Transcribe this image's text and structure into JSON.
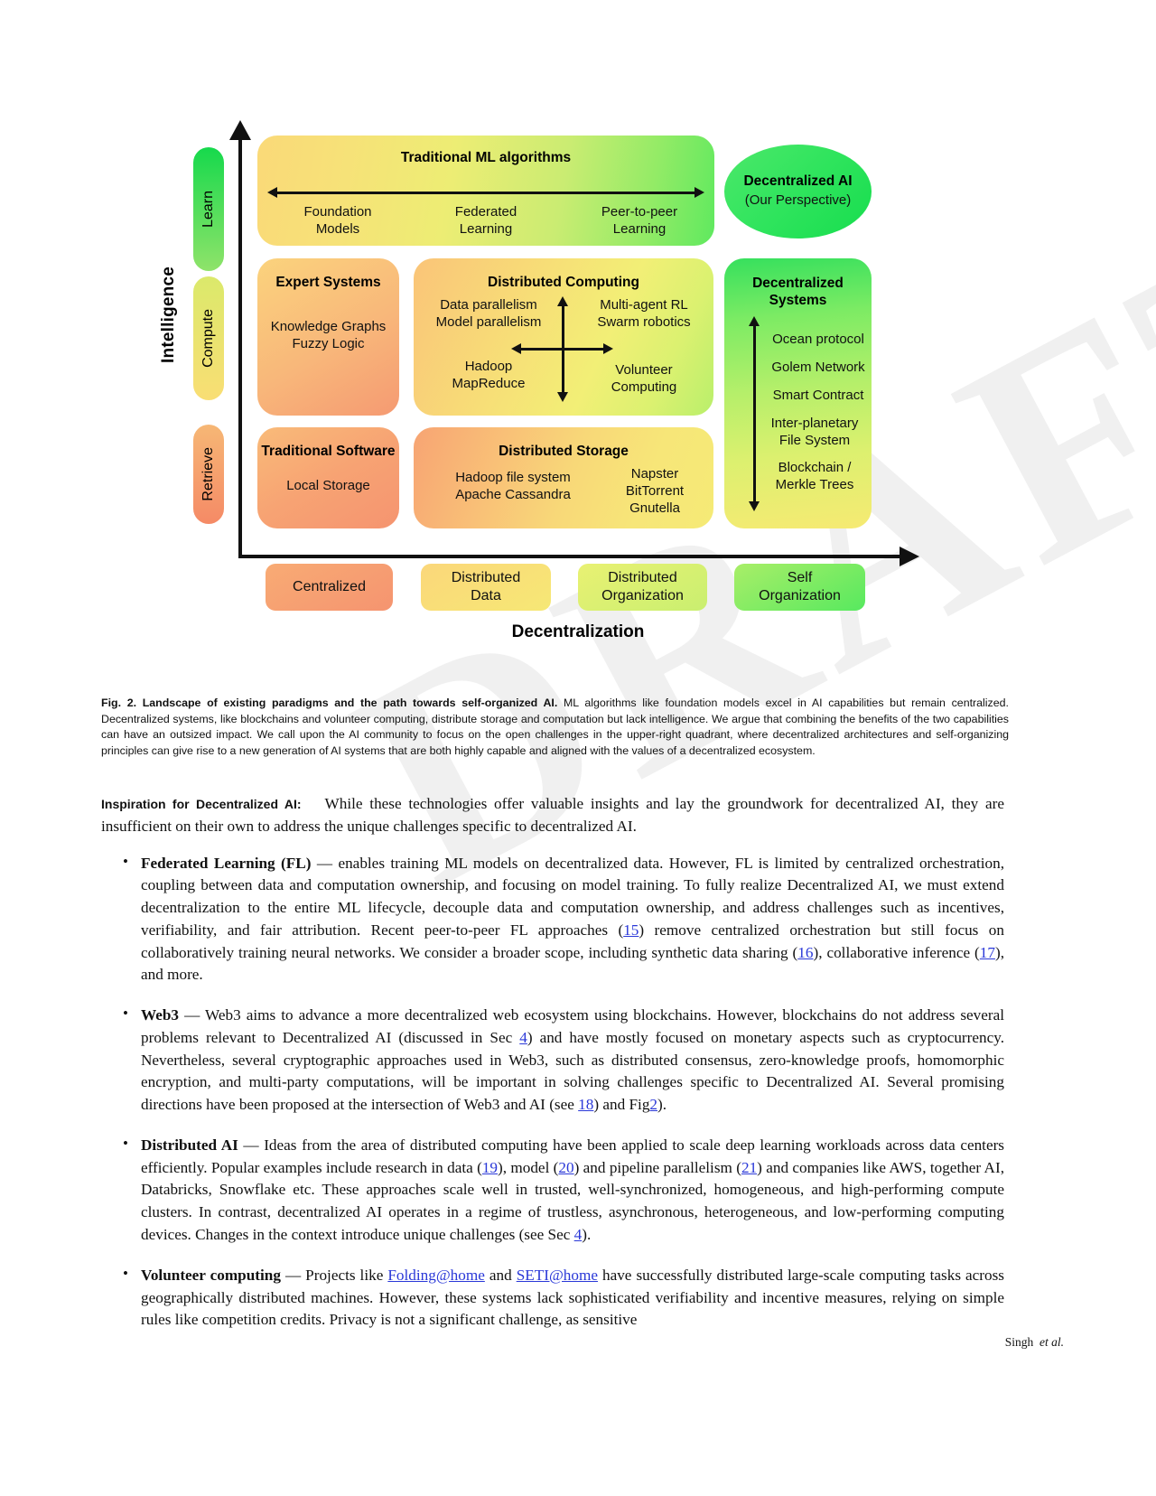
{
  "watermark": "DRAFT",
  "figure": {
    "y_axis_label": "Intelligence",
    "x_axis_label": "Decentralization",
    "tiers": [
      {
        "key": "learn",
        "label": "Learn"
      },
      {
        "key": "compute",
        "label": "Compute"
      },
      {
        "key": "retrieve",
        "label": "Retrieve"
      }
    ],
    "boxes": {
      "ml": {
        "title": "Traditional ML algorithms",
        "items": [
          "Foundation\nModels",
          "Federated\nLearning",
          "Peer-to-peer\nLearning"
        ],
        "item_left": "Foundation Models",
        "item_mid": "Federated Learning",
        "item_right": "Peer-to-peer Learning"
      },
      "dai": {
        "title": "Decentralized AI",
        "subtitle": "(Our Perspective)"
      },
      "expert": {
        "title": "Expert Systems",
        "items": "Knowledge Graphs\nFuzzy Logic"
      },
      "distributed_computing": {
        "title": "Distributed Computing",
        "tl": "Data parallelism\nModel parallelism",
        "tr": "Multi-agent RL\nSwarm robotics",
        "bl": "Hadoop\nMapReduce",
        "br": "Volunteer\nComputing"
      },
      "decentralized_systems": {
        "title": "Decentralized\nSystems",
        "items": [
          "Ocean protocol",
          "Golem Network",
          "Smart Contract",
          "Inter-planetary\nFile System",
          "Blockchain /\nMerkle Trees"
        ]
      },
      "traditional_software": {
        "title": "Traditional Software",
        "items": "Local Storage"
      },
      "distributed_storage": {
        "title": "Distributed Storage",
        "left": "Hadoop file system\nApache Cassandra",
        "right": "Napster\nBitTorrent\nGnutella"
      }
    },
    "x_categories": [
      "Centralized",
      "Distributed\nData",
      "Distributed\nOrganization",
      "Self\nOrganization"
    ],
    "colors": {
      "green": "#2fe45d",
      "yellow": "#f4e775",
      "orange": "#f59470",
      "axis": "#111111"
    }
  },
  "caption": {
    "label": "Fig. 2.",
    "bold_title": "Landscape of existing paradigms and the path towards self-organized AI.",
    "text": " ML algorithms like foundation models excel in AI capabilities but remain centralized. Decentralized systems, like blockchains and volunteer computing, distribute storage and computation but lack intelligence. We argue that combining the benefits of the two capabilities can have an outsized impact. We call upon the AI community to focus on the open challenges in the upper-right quadrant, where decentralized architectures and self-organizing principles can give rise to a new generation of AI systems that are both highly capable and aligned with the values of a decentralized ecosystem."
  },
  "body": {
    "lead_label": "Inspiration for Decentralized AI:",
    "lead_text": "While these technologies offer valuable insights and lay the groundwork for decentralized AI, they are insufficient on their own to address the unique challenges specific to decentralized AI.",
    "bullets": [
      {
        "term": "Federated Learning (FL)",
        "t1": " — enables training ML models on decentralized data. However, FL is limited by centralized orchestration, coupling between data and computation ownership, and focusing on model training. To fully realize Decentralized AI, we must extend decentralization to the entire ML lifecycle, decouple data and computation ownership, and address challenges such as incentives, verifiability, and fair attribution. Recent peer-to-peer FL approaches (",
        "r1": "15",
        "t2": ") remove centralized orchestration but still focus on collaboratively training neural networks. We consider a broader scope, including synthetic data sharing (",
        "r2": "16",
        "t3": "), collaborative inference (",
        "r3": "17",
        "t4": "), and more."
      },
      {
        "term": "Web3",
        "t1": " — Web3 aims to advance a more decentralized web ecosystem using blockchains. However, blockchains do not address several problems relevant to Decentralized AI (discussed in Sec ",
        "r1": "4",
        "t2": ") and have mostly focused on monetary aspects such as cryptocurrency. Nevertheless, several cryptographic approaches used in Web3, such as distributed consensus, zero-knowledge proofs, homomorphic encryption, and multi-party computations, will be important in solving challenges specific to Decentralized AI. Several promising directions have been proposed at the intersection of Web3 and AI (see ",
        "r2": "18",
        "t3": ") and Fig",
        "r3": "2",
        "t4": ")."
      },
      {
        "term": "Distributed AI",
        "t1": " — Ideas from the area of distributed computing have been applied to scale deep learning workloads across data centers efficiently. Popular examples include research in data (",
        "r1": "19",
        "t2": "), model (",
        "r2": "20",
        "t3": ") and pipeline parallelism (",
        "r3": "21",
        "t4": ") and companies like AWS, together AI, Databricks, Snowflake etc. These approaches scale well in trusted, well-synchronized, homogeneous, and high-performing compute clusters. In contrast, decentralized AI operates in a regime of trustless, asynchronous, heterogeneous, and low-performing computing devices. Changes in the context introduce unique challenges (see Sec ",
        "r4": "4",
        "t5": ")."
      },
      {
        "term": "Volunteer computing",
        "t1": " — Projects like ",
        "l1": "Folding@home",
        "t2": " and ",
        "l2": "SETI@home",
        "t3": " have successfully distributed large-scale computing tasks across geographically distributed machines. However, these systems lack sophisticated verifiability and incentive measures, relying on simple rules like competition credits. Privacy is not a significant challenge, as sensitive"
      }
    ]
  },
  "footer": {
    "authors": "Singh",
    "etal": "et al."
  }
}
